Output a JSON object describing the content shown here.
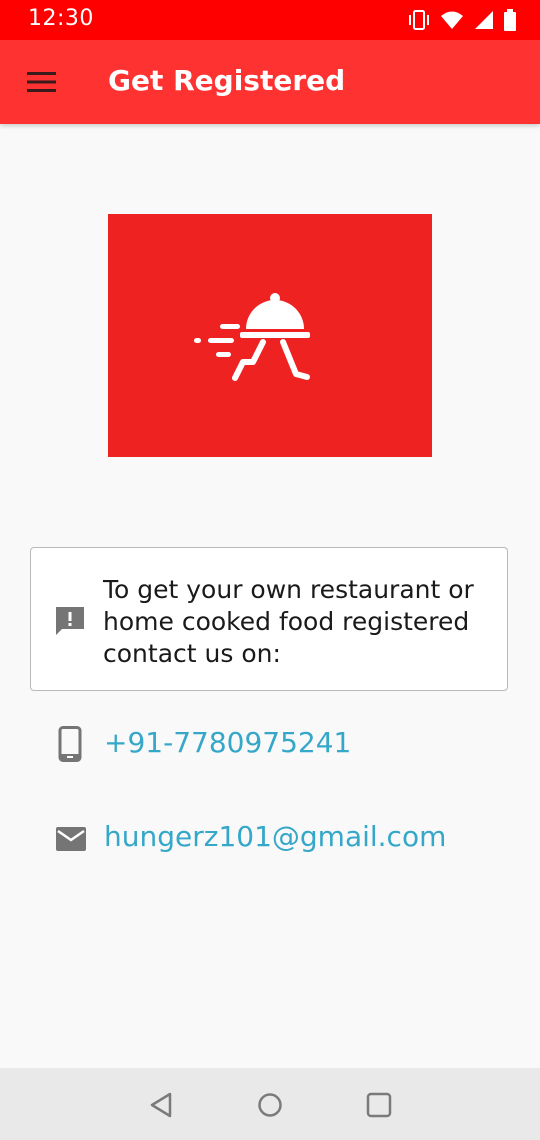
{
  "status_bar": {
    "time": "12:30",
    "icons": [
      "vibrate-icon",
      "wifi-icon",
      "signal-icon",
      "battery-icon"
    ]
  },
  "app_bar": {
    "title": "Get Registered",
    "menu_icon": "hamburger-menu-icon",
    "background_color": "#ff3232"
  },
  "logo": {
    "icon": "food-delivery-cloche-icon",
    "background_color": "#ef2222"
  },
  "info": {
    "icon": "feedback-alert-icon",
    "text": "To get your own restaurant or home cooked food registered contact us on:"
  },
  "contacts": {
    "phone": {
      "icon": "smartphone-icon",
      "value": "+91-7780975241"
    },
    "email": {
      "icon": "mail-icon",
      "value": "hungerz101@gmail.com"
    },
    "link_color": "#35a7c8"
  },
  "nav_bar": {
    "buttons": [
      "back-icon",
      "home-icon",
      "recents-icon"
    ]
  }
}
